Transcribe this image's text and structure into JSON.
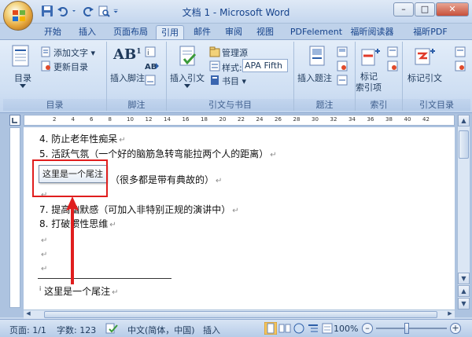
{
  "window": {
    "title": "文档 1 - Microsoft Word"
  },
  "tabs": [
    "开始",
    "插入",
    "页面布局",
    "引用",
    "邮件",
    "审阅",
    "视图",
    "PDFelement",
    "福昕阅读器",
    "福昕PDF"
  ],
  "ribbon": {
    "toc_group": {
      "toc_label": "目录",
      "add_text": "添加文字",
      "update_toc": "更新目录",
      "group_label": "目录"
    },
    "footnote_group": {
      "insert_footnote": "插入脚注",
      "group_label": "脚注"
    },
    "citation_group": {
      "insert_citation": "插入引文",
      "manage_sources": "管理源",
      "style_label": "样式:",
      "style_value": "APA Fifth",
      "bibliography": "书目",
      "group_label": "引文与书目"
    },
    "caption_group": {
      "insert_caption": "插入题注",
      "group_label": "题注"
    },
    "index_group": {
      "mark_entry_1": "标记",
      "mark_entry_2": "索引项",
      "group_label": "索引"
    },
    "citation_index_group": {
      "mark_citation": "标记引文",
      "group_label": "引文目录"
    }
  },
  "ruler": {
    "ticks": [
      "2",
      "4",
      "6",
      "8",
      "10",
      "12",
      "14",
      "16",
      "18",
      "20",
      "22",
      "24",
      "26",
      "28",
      "30",
      "32",
      "34",
      "36",
      "38",
      "40",
      "42"
    ]
  },
  "document": {
    "lines": [
      "4. 防止老年性痴呆",
      "5. 活跃气氛（一个好的脑筋急转弯能拉两个人的距离）",
      "（很多都是带有典故的）",
      "7. 提高幽默感（可加入非特别正规的演讲中）",
      "8. 打破惯性思维"
    ],
    "endnote_mark": "i",
    "endnote_text": "这里是一个尾注"
  },
  "tooltip": {
    "text": "这里是一个尾注"
  },
  "status": {
    "page": "页面: 1/1",
    "words": "字数: 123",
    "language": "中文(简体，中国)",
    "mode": "插入",
    "zoom": "100%"
  }
}
